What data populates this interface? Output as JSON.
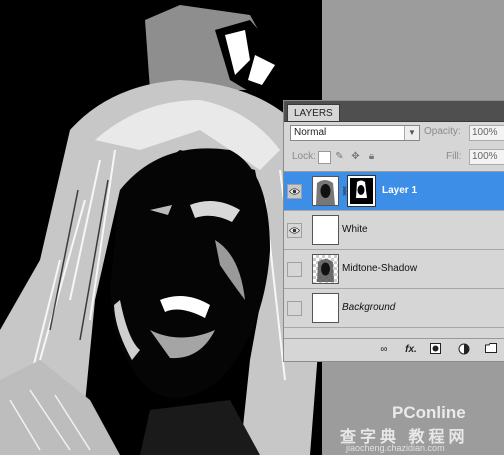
{
  "panel": {
    "tab_label": "LAYERS",
    "blend_mode": "Normal",
    "opacity_label": "Opacity:",
    "opacity_value": "100%",
    "lock_label": "Lock:",
    "fill_label": "Fill:",
    "fill_value": "100%"
  },
  "layers": [
    {
      "name": "Layer 1",
      "visible": true,
      "selected": true,
      "has_mask": true
    },
    {
      "name": "White",
      "visible": true,
      "selected": false,
      "has_mask": false
    },
    {
      "name": "Midtone-Shadow",
      "visible": false,
      "selected": false,
      "has_mask": false
    },
    {
      "name": "Background",
      "visible": false,
      "selected": false,
      "has_mask": false
    }
  ],
  "footer_icons": [
    "link-layers-icon",
    "fx-icon",
    "add-mask-icon",
    "adjustment-layer-icon",
    "new-group-icon"
  ],
  "watermark": {
    "brand": "PConline",
    "cn_text": "查字典 教程网",
    "url": "jiaocheng.chazidian.com"
  },
  "colors": {
    "selected_row": "#3d8ee6",
    "panel_bg": "#d6d6d6",
    "tab_bar": "#4f4f4f"
  }
}
